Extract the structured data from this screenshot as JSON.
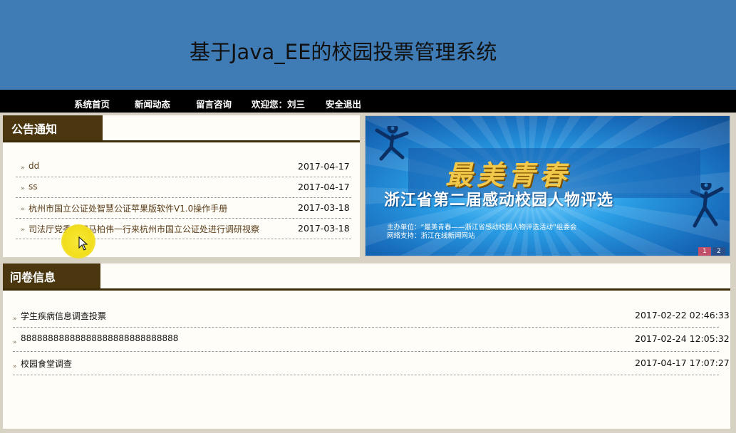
{
  "header": {
    "title": "基于Java_EE的校园投票管理系统"
  },
  "nav": {
    "items": [
      {
        "label": "系统首页"
      },
      {
        "label": "新闻动态"
      },
      {
        "label": "留言咨询"
      },
      {
        "label": "欢迎您：刘三"
      },
      {
        "label": "安全退出"
      }
    ]
  },
  "notice": {
    "title": "公告通知",
    "items": [
      {
        "title": "dd",
        "date": "2017-04-17"
      },
      {
        "title": "ss",
        "date": "2017-04-17"
      },
      {
        "title": "杭州市国立公证处智慧公证苹果版软件V1.0操作手册",
        "date": "2017-03-18"
      },
      {
        "title": "司法厅党委书记马柏伟一行来杭州市国立公证处进行调研视察",
        "date": "2017-03-18"
      }
    ]
  },
  "banner": {
    "heading": "最美青春",
    "subtitle": "浙江省第二届感动校园人物评选",
    "organizer": "主办单位：“最美青春——浙江省感动校园人物评选活动”组委会",
    "support": "网络支持：浙江在线新闻网站",
    "pages": [
      "1",
      "2"
    ],
    "colors": {
      "page_active": "#c0506a",
      "page_inactive": "#2c4f8a"
    }
  },
  "survey": {
    "title": "问卷信息",
    "items": [
      {
        "title": "学生疾病信息调查投票",
        "date": "2017-02-22 02:46:33"
      },
      {
        "title": "88888888888888888888888888888",
        "date": "2017-02-24 12:05:32"
      },
      {
        "title": "校园食堂调查",
        "date": "2017-04-17 17:07:27"
      }
    ]
  },
  "colors": {
    "header_bg": "#3f7bb4",
    "nav_bg": "#000000",
    "panel_tab": "#4a3710",
    "notice_link": "#5a3d1a"
  }
}
